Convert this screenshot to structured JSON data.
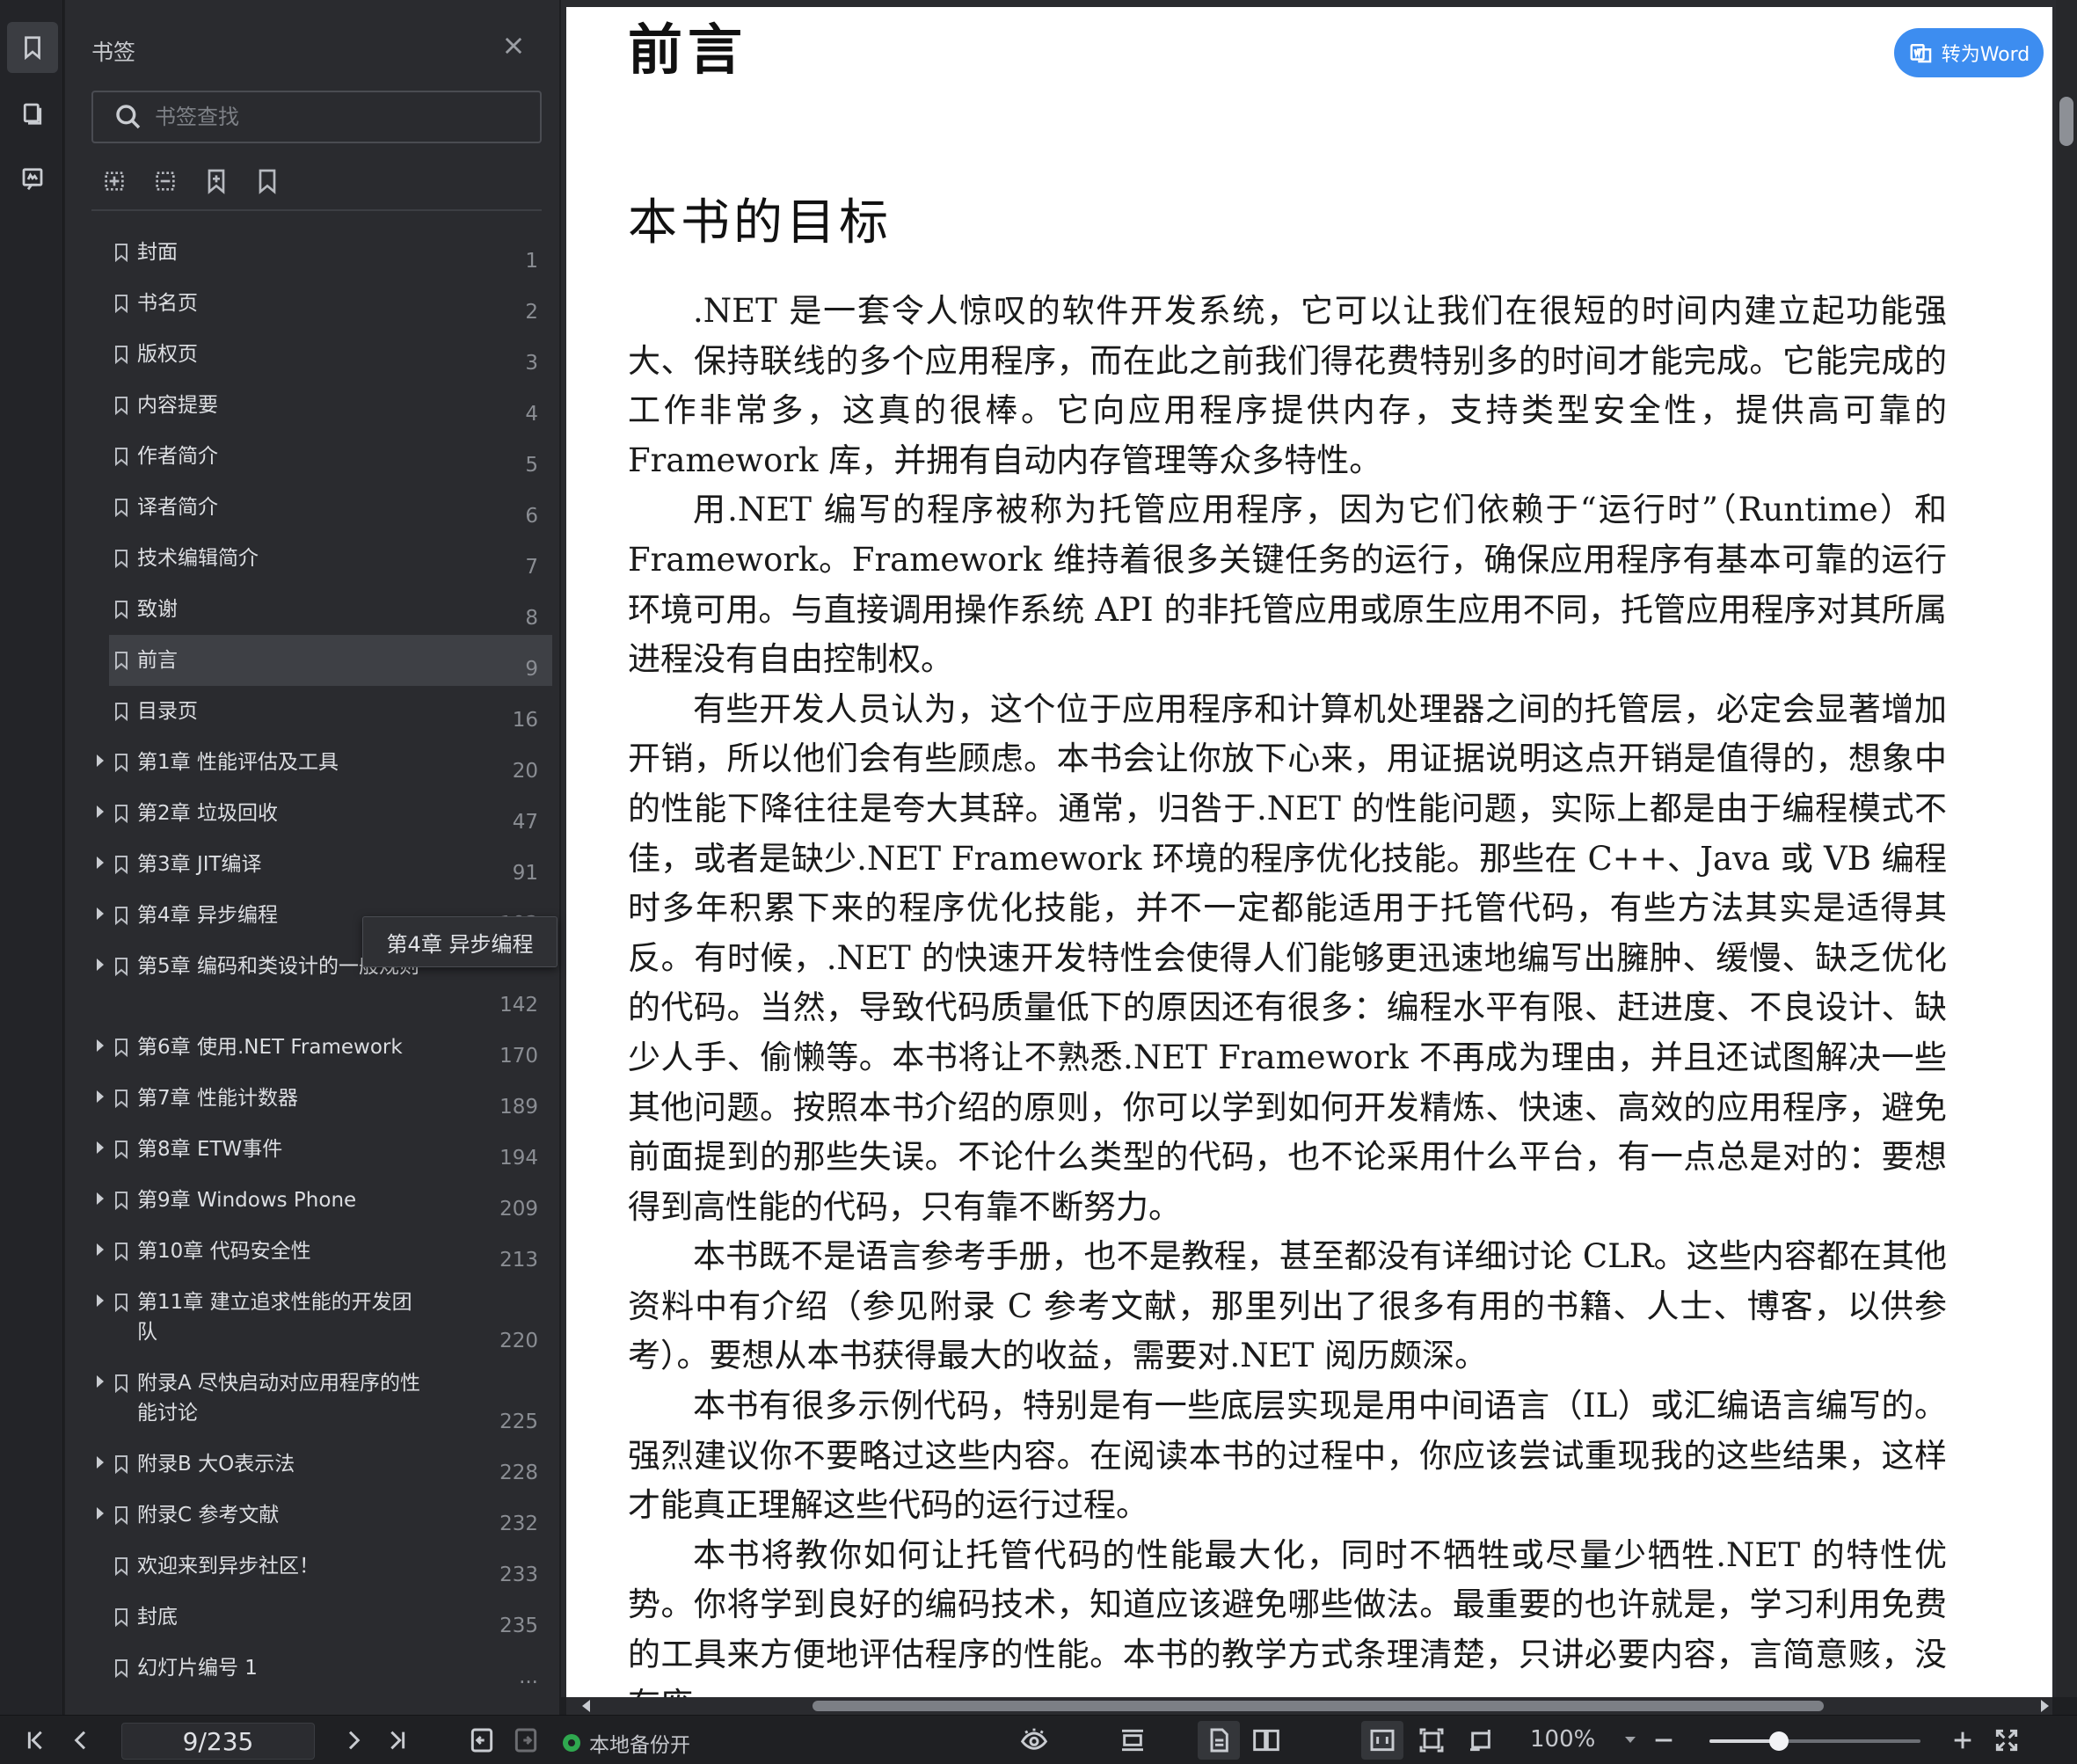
{
  "panel": {
    "title": "书签",
    "search_placeholder": "书签查找"
  },
  "rail": {
    "icons": [
      "bookmark-icon",
      "thumbnail-icon",
      "annotation-icon"
    ]
  },
  "bookmarks": [
    {
      "label": "封面",
      "page": "1",
      "expandable": false
    },
    {
      "label": "书名页",
      "page": "2",
      "expandable": false
    },
    {
      "label": "版权页",
      "page": "3",
      "expandable": false
    },
    {
      "label": "内容提要",
      "page": "4",
      "expandable": false
    },
    {
      "label": "作者简介",
      "page": "5",
      "expandable": false
    },
    {
      "label": "译者简介",
      "page": "6",
      "expandable": false
    },
    {
      "label": "技术编辑简介",
      "page": "7",
      "expandable": false
    },
    {
      "label": "致谢",
      "page": "8",
      "expandable": false
    },
    {
      "label": "前言",
      "page": "9",
      "expandable": false,
      "active": true
    },
    {
      "label": "目录页",
      "page": "16",
      "expandable": false
    },
    {
      "label": "第1章  性能评估及工具",
      "page": "20",
      "expandable": true
    },
    {
      "label": "第2章  垃圾回收",
      "page": "47",
      "expandable": true
    },
    {
      "label": "第3章  JIT编译",
      "page": "91",
      "expandable": true
    },
    {
      "label": "第4章  异步编程",
      "page": "103",
      "expandable": true,
      "hover": true
    },
    {
      "label": "第5章  编码和类设计的一般规则",
      "page": "142",
      "expandable": true,
      "tall": true
    },
    {
      "label": "第6章  使用.NET Framework",
      "page": "170",
      "expandable": true
    },
    {
      "label": "第7章  性能计数器",
      "page": "189",
      "expandable": true
    },
    {
      "label": "第8章  ETW事件",
      "page": "194",
      "expandable": true
    },
    {
      "label": "第9章  Windows Phone",
      "page": "209",
      "expandable": true
    },
    {
      "label": "第10章  代码安全性",
      "page": "213",
      "expandable": true
    },
    {
      "label": "第11章  建立追求性能的开发团队",
      "page": "220",
      "expandable": true,
      "tall": true
    },
    {
      "label": "附录A  尽快启动对应用程序的性能讨论",
      "page": "225",
      "expandable": true,
      "tall": true
    },
    {
      "label": "附录B  大O表示法",
      "page": "228",
      "expandable": true
    },
    {
      "label": "附录C  参考文献",
      "page": "232",
      "expandable": true
    },
    {
      "label": "欢迎来到异步社区！",
      "page": "233",
      "expandable": false
    },
    {
      "label": "封底",
      "page": "235",
      "expandable": false
    },
    {
      "label": "幻灯片编号 1",
      "page": "...",
      "expandable": false
    }
  ],
  "tooltip": "第4章  异步编程",
  "document": {
    "heading": "前言",
    "subheading": "本书的目标",
    "paragraphs": [
      ".NET 是一套令人惊叹的软件开发系统，它可以让我们在很短的时间内建立起功能强大、保持联线的多个应用程序，而在此之前我们得花费特别多的时间才能完成。它能完成的工作非常多，这真的很棒。它向应用程序提供内存，支持类型安全性，提供高可靠的 Framework 库，并拥有自动内存管理等众多特性。",
      "用.NET 编写的程序被称为托管应用程序，因为它们依赖于“运行时”（Runtime）和 Framework。Framework 维持着很多关键任务的运行，确保应用程序有基本可靠的运行环境可用。与直接调用操作系统 API 的非托管应用或原生应用不同，托管应用程序对其所属进程没有自由控制权。",
      "有些开发人员认为，这个位于应用程序和计算机处理器之间的托管层，必定会显著增加开销，所以他们会有些顾虑。本书会让你放下心来，用证据说明这点开销是值得的，想象中的性能下降往往是夸大其辞。通常，归咎于.NET 的性能问题，实际上都是由于编程模式不佳，或者是缺少.NET Framework 环境的程序优化技能。那些在 C++、Java 或 VB 编程时多年积累下来的程序优化技能，并不一定都能适用于托管代码，有些方法其实是适得其反。有时候，.NET 的快速开发特性会使得人们能够更迅速地编写出臃肿、缓慢、缺乏优化的代码。当然，导致代码质量低下的原因还有很多：编程水平有限、赶进度、不良设计、缺少人手、偷懒等。本书将让不熟悉.NET Framework 不再成为理由，并且还试图解决一些其他问题。按照本书介绍的原则，你可以学到如何开发精炼、快速、高效的应用程序，避免前面提到的那些失误。不论什么类型的代码，也不论采用什么平台，有一点总是对的：要想得到高性能的代码，只有靠不断努力。",
      "本书既不是语言参考手册，也不是教程，甚至都没有详细讨论 CLR。这些内容都在其他资料中有介绍（参见附录 C 参考文献，那里列出了很多有用的书籍、人士、博客，以供参考）。要想从本书获得最大的收益，需要对.NET 阅历颇深。",
      "本书有很多示例代码，特别是有一些底层实现是用中间语言（IL）或汇编语言编写的。强烈建议你不要略过这些内容。在阅读本书的过程中，你应该尝试重现我的这些结果，这样才能真正理解这些代码的运行过程。",
      "本书将教你如何让托管代码的性能最大化，同时不牺牲或尽量少牺牲.NET 的特性优势。你将学到良好的编码技术，知道应该避免哪些做法。最重要的也许就是，学习利用免费的工具来方便地评估程序的性能。本书的教学方式条理清楚，只讲必要内容，言简意赅，没有废"
    ]
  },
  "convert_button": "转为Word",
  "statusbar": {
    "page_indicator": "9/235",
    "backup_label": "本地备份开",
    "zoom": "100%",
    "zoom_fraction": 0.33
  },
  "colors": {
    "accent": "#3d8df0",
    "backup_on": "#2fa84f"
  }
}
